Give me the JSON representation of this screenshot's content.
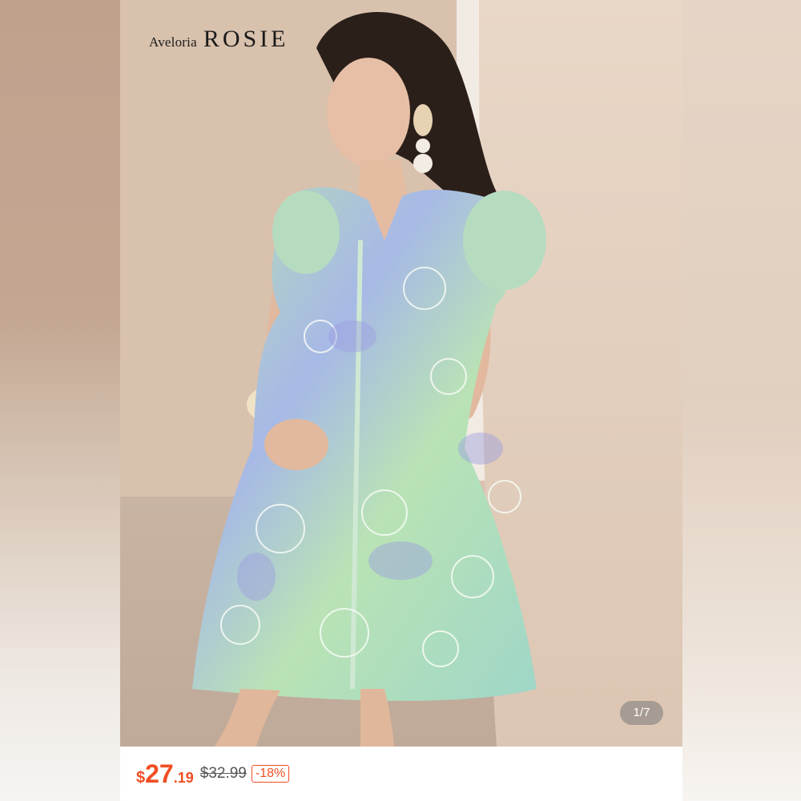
{
  "brand": {
    "prefix": "Aveloria",
    "name": "ROSIE"
  },
  "gallery": {
    "counter": "1/7"
  },
  "pricing": {
    "currency": "$",
    "price_int": "27",
    "price_dec": ".19",
    "original_price": "$32.99",
    "discount": "-18%"
  },
  "colors": {
    "accent": "#f04e23",
    "dress_green": "#a8d8a0",
    "dress_lavender": "#a9a8e0"
  },
  "icons": {
    "gallery": "product-photo"
  }
}
